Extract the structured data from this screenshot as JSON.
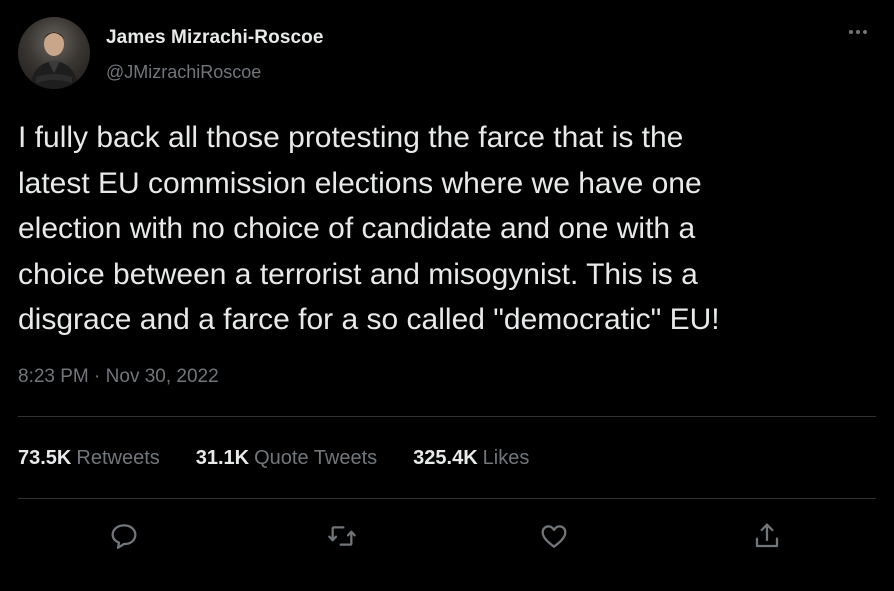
{
  "author": {
    "display_name": "James Mizrachi-Roscoe",
    "handle": "@JMizrachiRoscoe"
  },
  "tweet": {
    "text": "I fully back all those protesting the farce that is the\nlatest EU commission elections where we have one\nelection with no choice of candidate and one with a\nchoice between a terrorist and misogynist. This is a\ndisgrace and a farce for a so called \"democratic\" EU!",
    "time": "8:23 PM",
    "separator": " · ",
    "date": "Nov 30, 2022"
  },
  "stats": {
    "retweets_count": "73.5K",
    "retweets_label": "Retweets",
    "quotes_count": "31.1K",
    "quotes_label": "Quote Tweets",
    "likes_count": "325.4K",
    "likes_label": "Likes"
  },
  "icons": {
    "more": "more-horizontal-icon",
    "reply": "reply-icon",
    "retweet": "retweet-icon",
    "like": "heart-icon",
    "share": "share-icon"
  },
  "colors": {
    "background": "#000000",
    "primary_text": "#e7e9ea",
    "secondary_text": "#71767b",
    "divider": "#2f3336"
  }
}
